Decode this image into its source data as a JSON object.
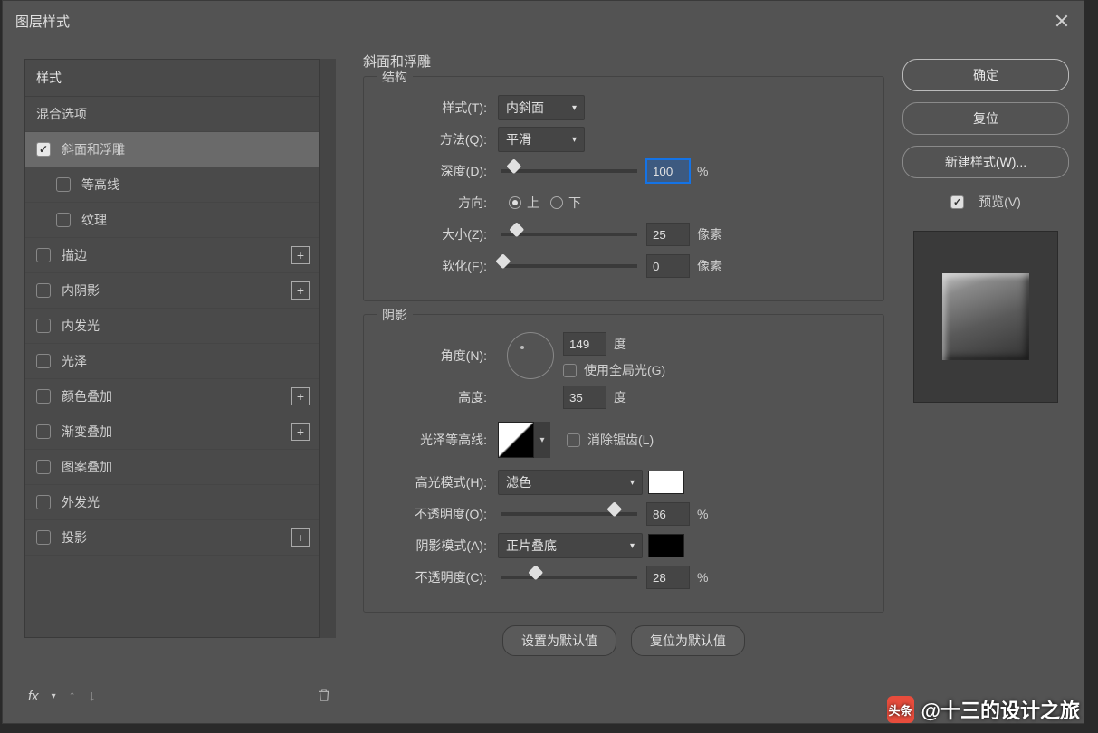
{
  "window": {
    "title": "图层样式"
  },
  "sidebar": {
    "header": "样式",
    "blend_options": "混合选项",
    "items": [
      {
        "label": "斜面和浮雕",
        "checked": true,
        "selected": true,
        "plus": false,
        "sub": false,
        "name": "bevel-emboss"
      },
      {
        "label": "等高线",
        "checked": false,
        "selected": false,
        "plus": false,
        "sub": true,
        "name": "contour"
      },
      {
        "label": "纹理",
        "checked": false,
        "selected": false,
        "plus": false,
        "sub": true,
        "name": "texture"
      },
      {
        "label": "描边",
        "checked": false,
        "selected": false,
        "plus": true,
        "sub": false,
        "name": "stroke"
      },
      {
        "label": "内阴影",
        "checked": false,
        "selected": false,
        "plus": true,
        "sub": false,
        "name": "inner-shadow"
      },
      {
        "label": "内发光",
        "checked": false,
        "selected": false,
        "plus": false,
        "sub": false,
        "name": "inner-glow"
      },
      {
        "label": "光泽",
        "checked": false,
        "selected": false,
        "plus": false,
        "sub": false,
        "name": "satin"
      },
      {
        "label": "颜色叠加",
        "checked": false,
        "selected": false,
        "plus": true,
        "sub": false,
        "name": "color-overlay"
      },
      {
        "label": "渐变叠加",
        "checked": false,
        "selected": false,
        "plus": true,
        "sub": false,
        "name": "gradient-overlay"
      },
      {
        "label": "图案叠加",
        "checked": false,
        "selected": false,
        "plus": false,
        "sub": false,
        "name": "pattern-overlay"
      },
      {
        "label": "外发光",
        "checked": false,
        "selected": false,
        "plus": false,
        "sub": false,
        "name": "outer-glow"
      },
      {
        "label": "投影",
        "checked": false,
        "selected": false,
        "plus": true,
        "sub": false,
        "name": "drop-shadow"
      }
    ],
    "footer_fx": "fx"
  },
  "panel": {
    "title": "斜面和浮雕",
    "structure": {
      "legend": "结构",
      "style_label": "样式(T):",
      "style_value": "内斜面",
      "technique_label": "方法(Q):",
      "technique_value": "平滑",
      "depth_label": "深度(D):",
      "depth_value": "100",
      "depth_unit": "%",
      "direction_label": "方向:",
      "direction_up": "上",
      "direction_down": "下",
      "size_label": "大小(Z):",
      "size_value": "25",
      "size_unit": "像素",
      "soften_label": "软化(F):",
      "soften_value": "0",
      "soften_unit": "像素"
    },
    "shading": {
      "legend": "阴影",
      "angle_label": "角度(N):",
      "angle_value": "149",
      "angle_unit": "度",
      "global_light_label": "使用全局光(G)",
      "altitude_label": "高度:",
      "altitude_value": "35",
      "altitude_unit": "度",
      "gloss_label": "光泽等高线:",
      "antialias_label": "消除锯齿(L)",
      "highlight_mode_label": "高光模式(H):",
      "highlight_mode_value": "滤色",
      "highlight_opacity_label": "不透明度(O):",
      "highlight_opacity_value": "86",
      "percent": "%",
      "shadow_mode_label": "阴影模式(A):",
      "shadow_mode_value": "正片叠底",
      "shadow_opacity_label": "不透明度(C):",
      "shadow_opacity_value": "28"
    },
    "defaults": {
      "make": "设置为默认值",
      "reset": "复位为默认值"
    }
  },
  "buttons": {
    "ok": "确定",
    "cancel": "复位",
    "new_style": "新建样式(W)...",
    "preview_label": "预览(V)"
  },
  "watermark": {
    "logo": "头条",
    "text": "@十三的设计之旅"
  }
}
